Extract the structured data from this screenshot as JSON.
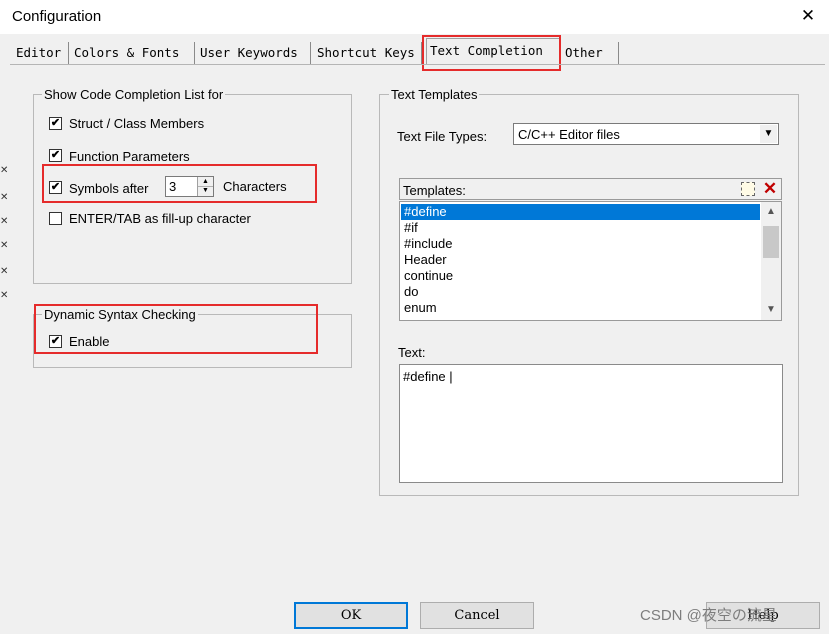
{
  "window": {
    "title": "Configuration",
    "close_glyph": "✕"
  },
  "tabs": [
    {
      "label": "Editor",
      "active": false
    },
    {
      "label": "Colors & Fonts",
      "active": false
    },
    {
      "label": "User Keywords",
      "active": false
    },
    {
      "label": "Shortcut Keys",
      "active": false
    },
    {
      "label": "Text Completion",
      "active": true
    },
    {
      "label": "Other",
      "active": false
    }
  ],
  "completion": {
    "group_label": "Show Code Completion List for",
    "options": [
      {
        "label": "Struct / Class Members",
        "checked": true
      },
      {
        "label": "Function Parameters",
        "checked": true
      },
      {
        "label": "Symbols after",
        "checked": true
      },
      {
        "label": "ENTER/TAB as fill-up character",
        "checked": false
      }
    ],
    "symbols_count": "3",
    "characters_label": "Characters"
  },
  "syntax": {
    "group_label": "Dynamic Syntax Checking",
    "enable_label": "Enable",
    "enabled": true
  },
  "templates": {
    "group_label": "Text Templates",
    "file_types_label": "Text File Types:",
    "file_types_value": "C/C++ Editor files",
    "list_label": "Templates:",
    "items": [
      "#define",
      "#if",
      "#include",
      "Header",
      "continue",
      "do",
      "enum"
    ],
    "selected": "#define",
    "text_label": "Text:",
    "text_value": "#define |"
  },
  "buttons": {
    "ok": "OK",
    "cancel": "Cancel",
    "help": "Help"
  },
  "watermark": "CSDN @夜空の流星",
  "icons": {
    "check": "✔",
    "new": "new-template-icon",
    "delete": "✕",
    "up": "▲",
    "down": "▼",
    "combo_arrow": "▼"
  },
  "colors": {
    "selection": "#0078d7",
    "highlight_box": "#e52b2b",
    "delete_icon": "#c00000"
  }
}
